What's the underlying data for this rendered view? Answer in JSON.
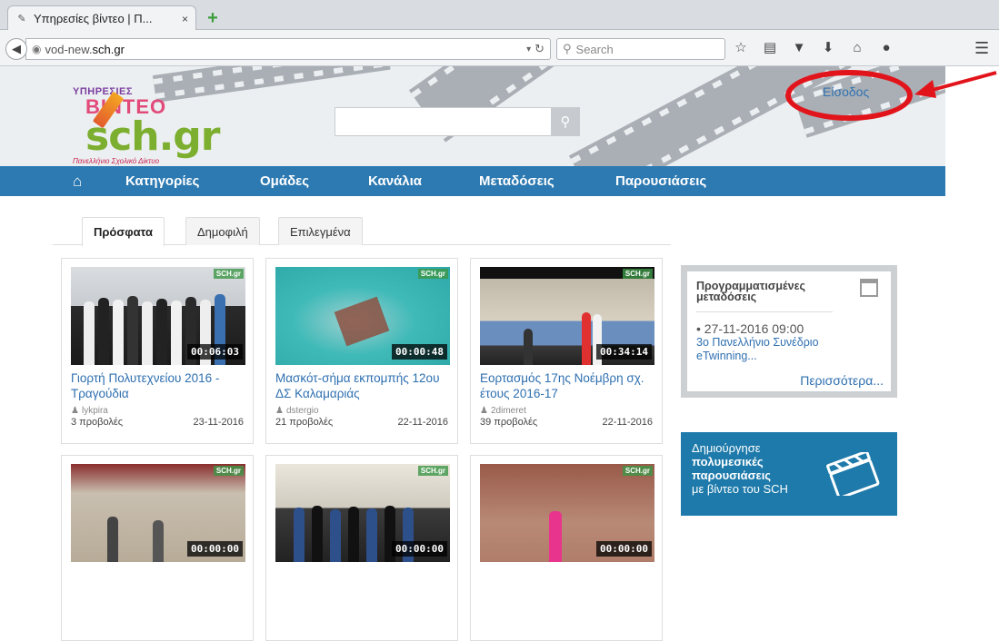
{
  "browser": {
    "tab_title": "Υπηρεσίες βίντεο | Π...",
    "tab_close": "×",
    "new_tab": "+",
    "url_prefix": "vod-new.",
    "url_domain": "sch.gr",
    "search_placeholder": "Search"
  },
  "header": {
    "logo_line1": "ΥΠΗΡΕΣΙΕΣ",
    "logo_line2": "ΒΙΝΤΕΟ",
    "logo_line3": "sch.gr",
    "logo_line4": "Πανελλήνιο Σχολικό Δίκτυο",
    "login_label": "Είσοδος"
  },
  "nav": {
    "items": [
      "Κατηγορίες",
      "Ομάδες",
      "Κανάλια",
      "Μεταδόσεις",
      "Παρουσιάσεις"
    ]
  },
  "tabs": {
    "items": [
      "Πρόσφατα",
      "Δημοφιλή",
      "Επιλεγμένα"
    ],
    "active": "Πρόσφατα"
  },
  "videos": [
    {
      "badge": "SCH.gr",
      "duration": "00:06:03",
      "title": "Γιορτή Πολυτεχνείου 2016 - Τραγούδια",
      "user": "lykpira",
      "views": "3 προβολές",
      "date": "23-11-2016"
    },
    {
      "badge": "SCH.gr",
      "duration": "00:00:48",
      "title": "Μασκότ-σήμα εκπομπής 12ου ΔΣ Καλαμαριάς",
      "user": "dstergio",
      "views": "21 προβολές",
      "date": "22-11-2016"
    },
    {
      "badge": "SCH.gr",
      "duration": "00:34:14",
      "title": "Εορτασμός 17ης Νοέμβρη σχ. έτους 2016-17",
      "user": "2dimeret",
      "views": "39 προβολές",
      "date": "22-11-2016"
    },
    {
      "badge": "SCH.gr",
      "duration": "00:00:00"
    },
    {
      "badge": "SCH.gr",
      "duration": "00:00:00"
    },
    {
      "badge": "SCH.gr",
      "duration": "00:00:00"
    }
  ],
  "scheduled": {
    "title": "Προγραμματισμένες μεταδόσεις",
    "date": "• 27-11-2016 09:00",
    "link": "3ο Πανελλήνιο Συνέδριο eTwinning...",
    "more": "Περισσότερα..."
  },
  "promo": {
    "line1": "Δημιούργησε",
    "line2": "πολυμεσικές",
    "line3": "παρουσιάσεις",
    "line4": "με βίντεο του SCH"
  },
  "colors": {
    "nav_blue": "#2d7ab2",
    "link_blue": "#2e6fb0",
    "highlight_red": "#e2141b",
    "promo_blue": "#1e7aaa"
  }
}
